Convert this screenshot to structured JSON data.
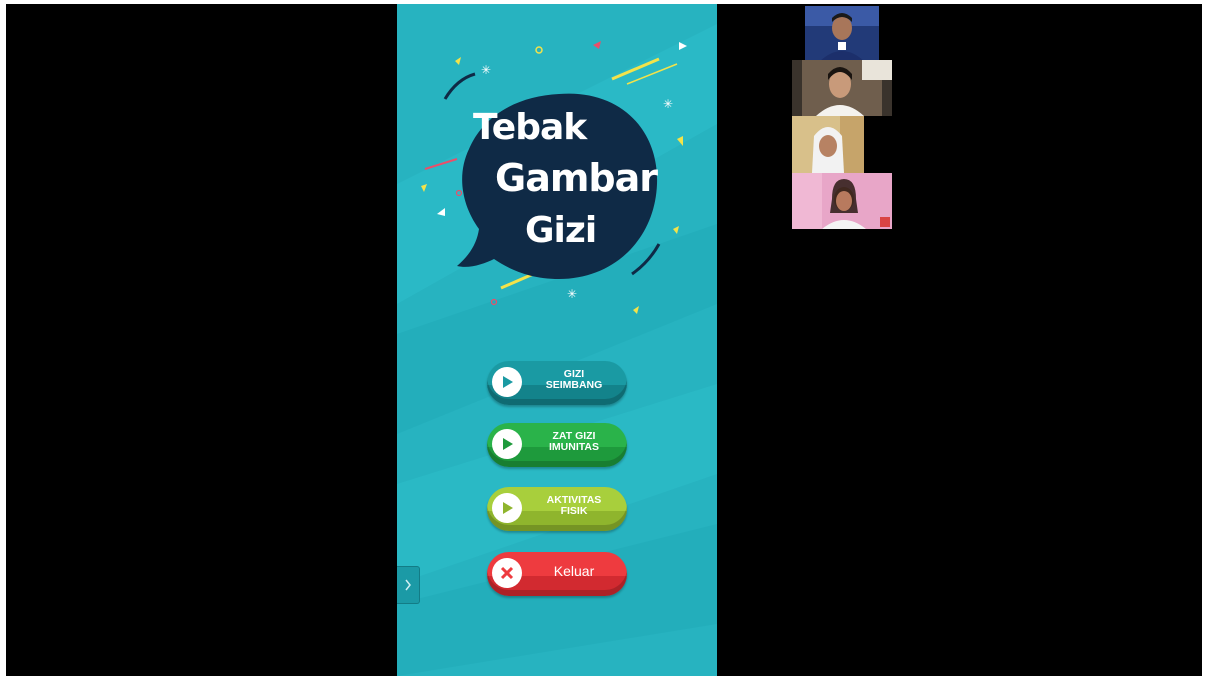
{
  "app": {
    "title_lines": [
      "Tebak",
      "Gambar",
      "Gizi"
    ],
    "buttons": [
      {
        "label": "GIZI\nSEIMBANG",
        "icon": "play-icon",
        "color": "#1a9aa3"
      },
      {
        "label": "ZAT GIZI\nIMUNITAS",
        "icon": "play-icon",
        "color": "#2ab34a"
      },
      {
        "label": "AKTIVITAS\nFISIK",
        "icon": "play-icon",
        "color": "#a8cf3c"
      },
      {
        "label": "Keluar",
        "icon": "close-x-icon",
        "color": "#ee3b3f"
      }
    ],
    "background_color": "#27b3c0",
    "bubble_color": "#0f2a46"
  },
  "sidebar_toggle": {
    "icon": "chevron-right-icon"
  },
  "participants": [
    {
      "icon": "participant-video-1"
    },
    {
      "icon": "participant-video-2"
    },
    {
      "icon": "participant-video-3"
    },
    {
      "icon": "participant-video-4"
    }
  ]
}
